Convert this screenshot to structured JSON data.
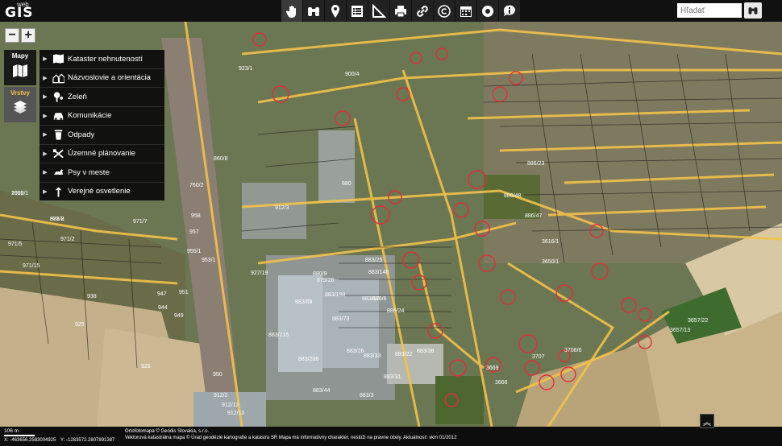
{
  "logo": {
    "web": "web",
    "gis": "GIS"
  },
  "toolbar": {
    "tools": [
      {
        "name": "pan-hand-icon",
        "active": true
      },
      {
        "name": "binoculars-icon",
        "active": false
      },
      {
        "name": "location-pin-icon",
        "active": false
      },
      {
        "name": "list-icon",
        "active": false
      },
      {
        "name": "measure-icon",
        "active": false
      },
      {
        "name": "print-icon",
        "active": false
      },
      {
        "name": "link-icon",
        "active": false
      },
      {
        "name": "copyright-icon",
        "active": false
      },
      {
        "name": "calendar-icon",
        "active": false
      },
      {
        "name": "help-lifebuoy-icon",
        "active": false
      },
      {
        "name": "info-bubble-icon",
        "active": false
      }
    ]
  },
  "search": {
    "placeholder": "Hľadať",
    "button_icon": "binoculars-icon"
  },
  "zoom": {
    "minus": "−",
    "plus": "+"
  },
  "tabs": {
    "maps": "Mapy",
    "layers": "Vrstvy"
  },
  "menu": {
    "items": [
      {
        "label": "Kataster nehnuteností",
        "icon": "map-icon"
      },
      {
        "label": "Názvoslovie a orientácia",
        "icon": "houses-icon"
      },
      {
        "label": "Zeleň",
        "icon": "tree-icon"
      },
      {
        "label": "Komunikácie",
        "icon": "car-icon"
      },
      {
        "label": "Odpady",
        "icon": "trash-icon"
      },
      {
        "label": "Územné plánovanie",
        "icon": "planning-icon"
      },
      {
        "label": "Psy v meste",
        "icon": "dog-icon"
      },
      {
        "label": "Verejné osvetlenie",
        "icon": "lamp-icon"
      }
    ]
  },
  "map": {
    "parcel_labels": [
      "1099/1",
      "971/8",
      "971/7",
      "971/5",
      "971/2",
      "971/15",
      "958",
      "957",
      "955/1",
      "953/1",
      "947",
      "951",
      "938",
      "925",
      "926",
      "944",
      "949",
      "950",
      "912/2",
      "912/12",
      "912/10",
      "912/3",
      "880",
      "880/9",
      "879/26",
      "883/188",
      "883/73",
      "883/68",
      "883/215",
      "883/26",
      "883/33",
      "883/208",
      "883/22",
      "883/38",
      "883/31",
      "883/44",
      "883/3",
      "883/17",
      "883/25",
      "883/148",
      "886/6",
      "886/24",
      "886/23",
      "886/48",
      "886/47",
      "3616/1",
      "3650/1",
      "3657/13",
      "3657/22",
      "3708/6",
      "3707",
      "3666",
      "3669",
      "900/4",
      "860/8",
      "760/2",
      "923/1",
      "927/19",
      "2922",
      "888/2"
    ]
  },
  "bottom": {
    "scale_label": "106 m",
    "coord_x": "X: -463656.2583004925",
    "coord_y": "Y: -1283572.2807891387",
    "attribution_1": "Ortofotomapa © Geodis Slovakia, s.r.o.",
    "attribution_2": "Vektorová katastrálna mapa © Úrad geodézie kartografie a katastra SR Mapa má informatívny charakter, neslúži na právne účely. Aktuálnosť: vkm 01/2012"
  },
  "colors": {
    "accent": "#f3c24a",
    "roads": "#f3c24a",
    "parcels": "#222222",
    "markers": "#e0303a"
  }
}
